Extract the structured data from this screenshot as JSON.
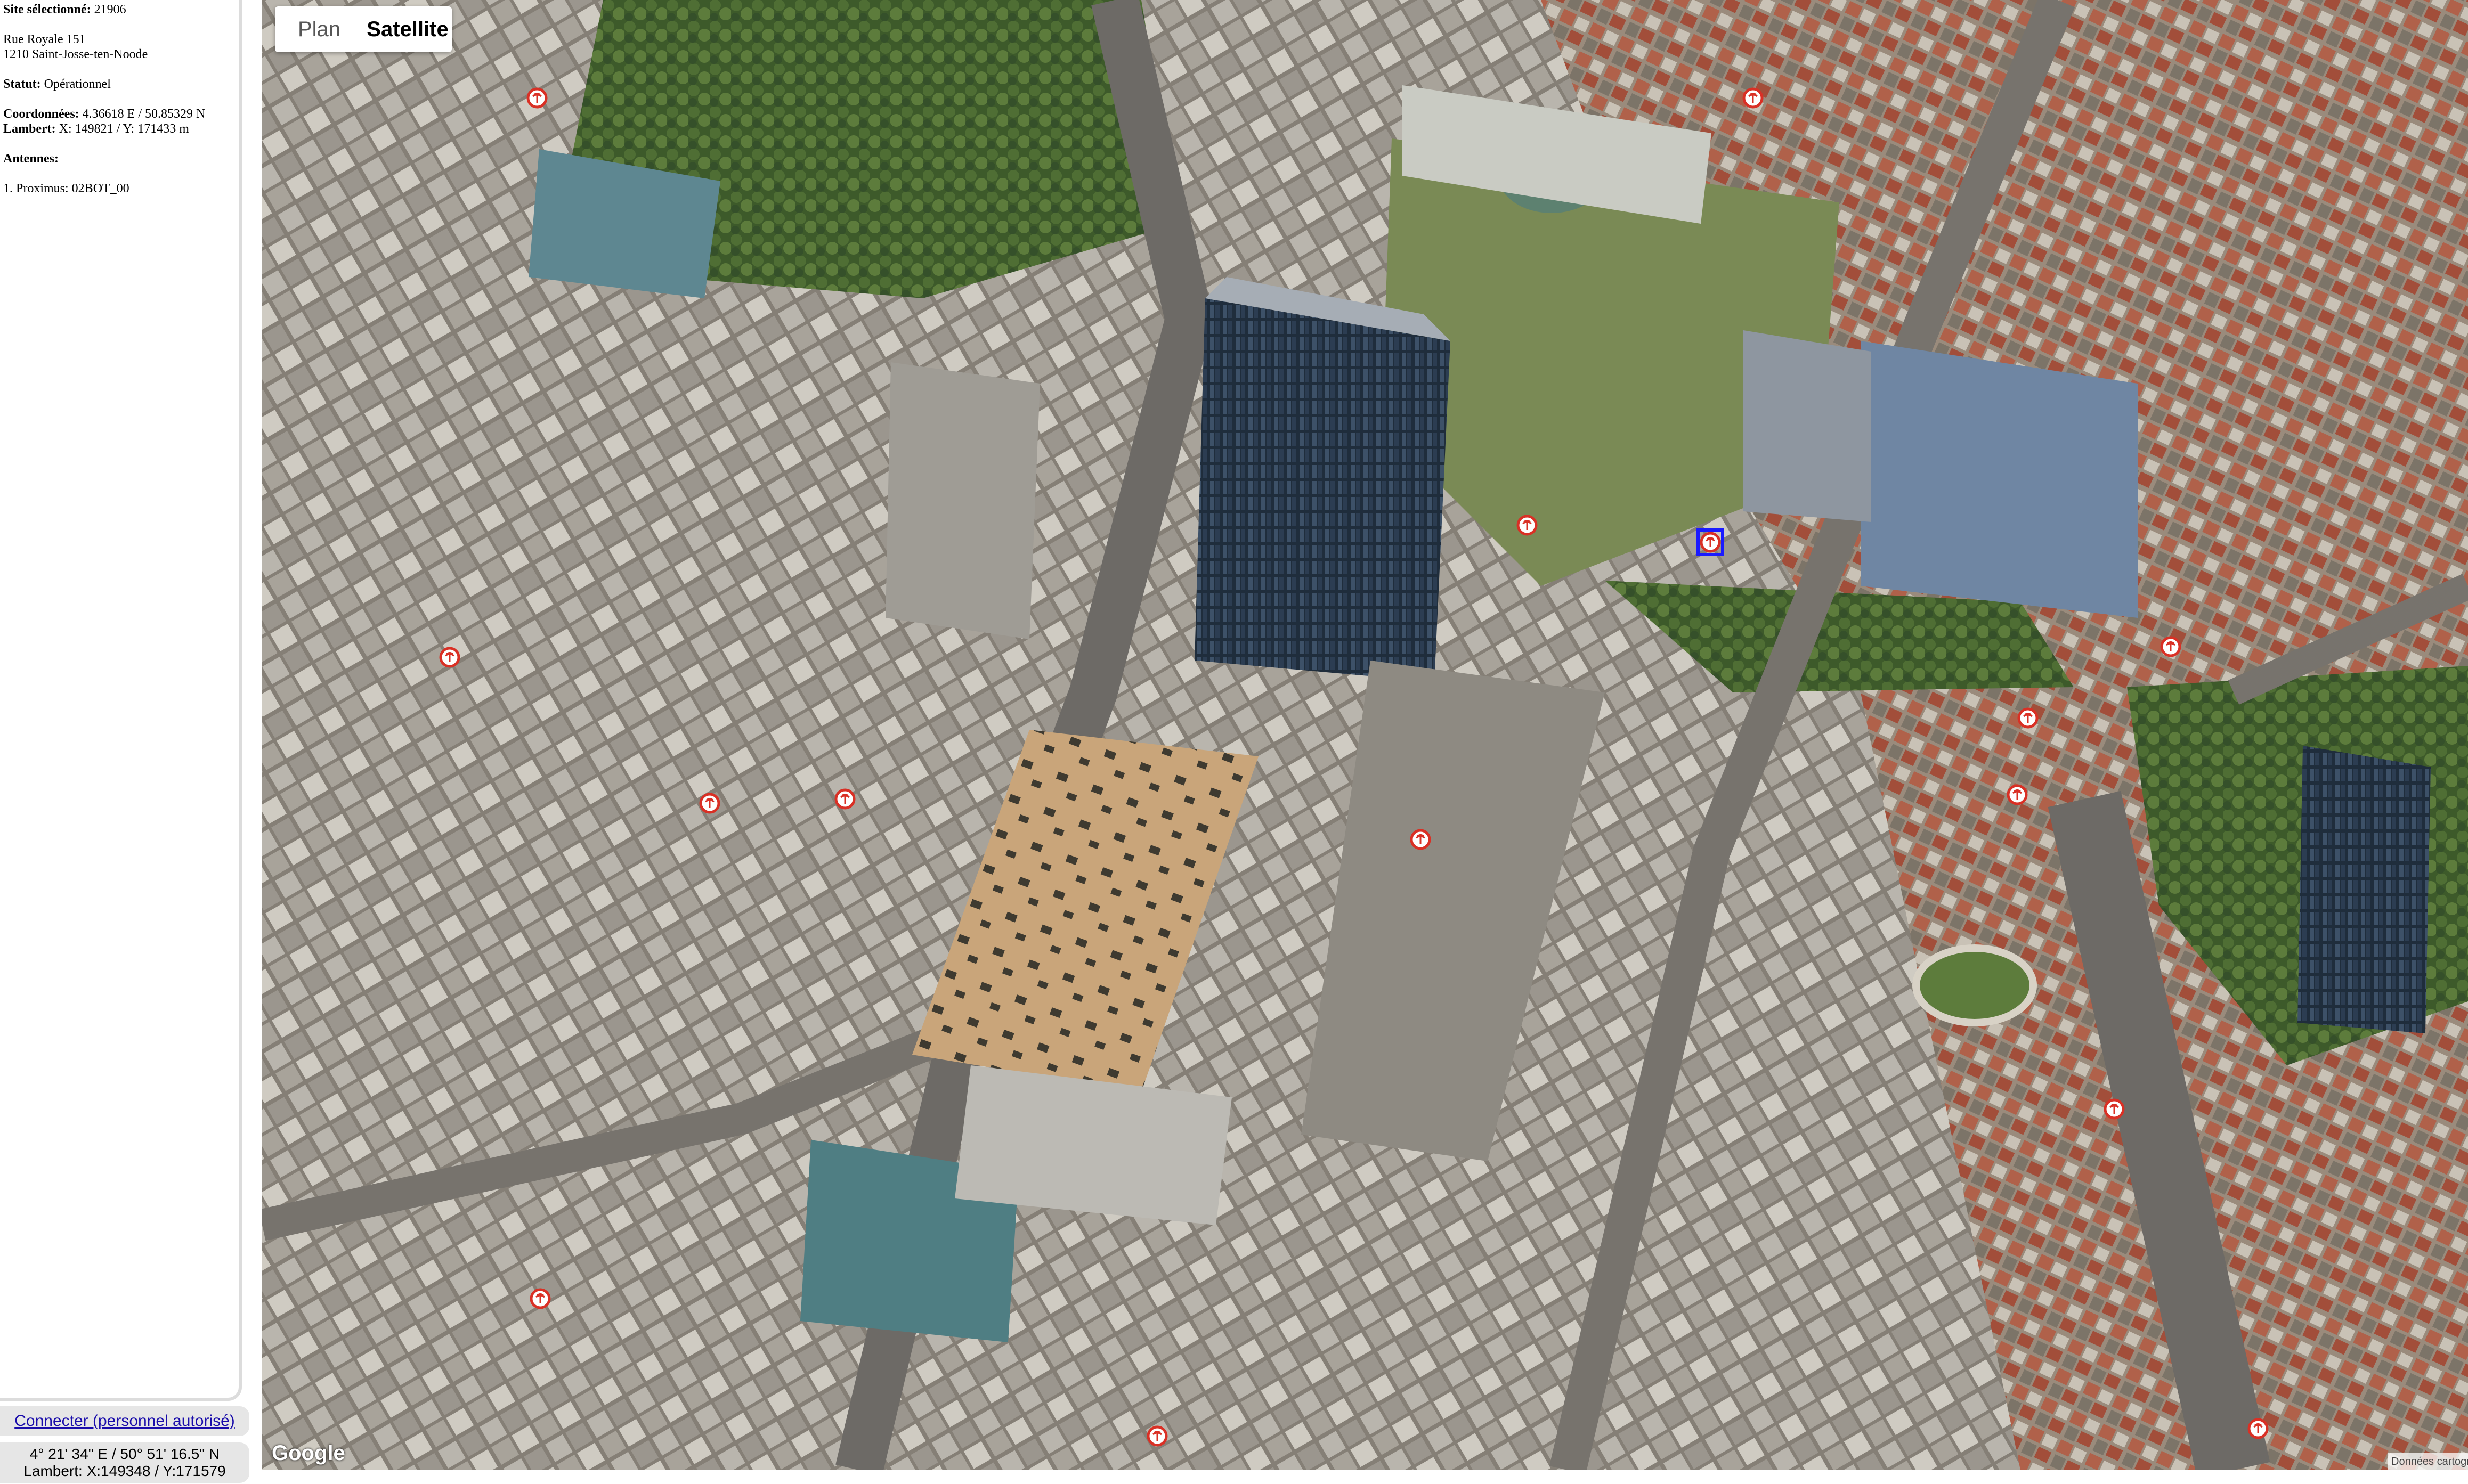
{
  "panel": {
    "site_label": "Site sélectionné:",
    "site_id": "21906",
    "address_line1": "Rue Royale 151",
    "address_line2": "1210 Saint-Josse-ten-Noode",
    "status_label": "Statut:",
    "status_value": "Opérationnel",
    "coords_label": "Coordonnées:",
    "coords_value": "4.36618 E / 50.85329 N",
    "lambert_label": "Lambert:",
    "lambert_value": "X: 149821 / Y: 171433 m",
    "antennas_label": "Antennes:",
    "antennas": [
      "1. Proximus: 02BOT_00"
    ]
  },
  "login_link": "Connecter (personnel autorisé)",
  "cursor_coords": {
    "line1": "4° 21' 34\" E / 50° 51' 16.5\" N",
    "line2": "Lambert: X:149348 / Y:171579"
  },
  "map": {
    "type_plan": "Plan",
    "type_satellite": "Satellite",
    "active_type": "Satellite",
    "logo": "Google",
    "attribution": "Données cartographiques",
    "marker_icon": "antenna-site-icon",
    "marker_color": "#d93025",
    "selected_outline_color": "#1a1aff"
  }
}
